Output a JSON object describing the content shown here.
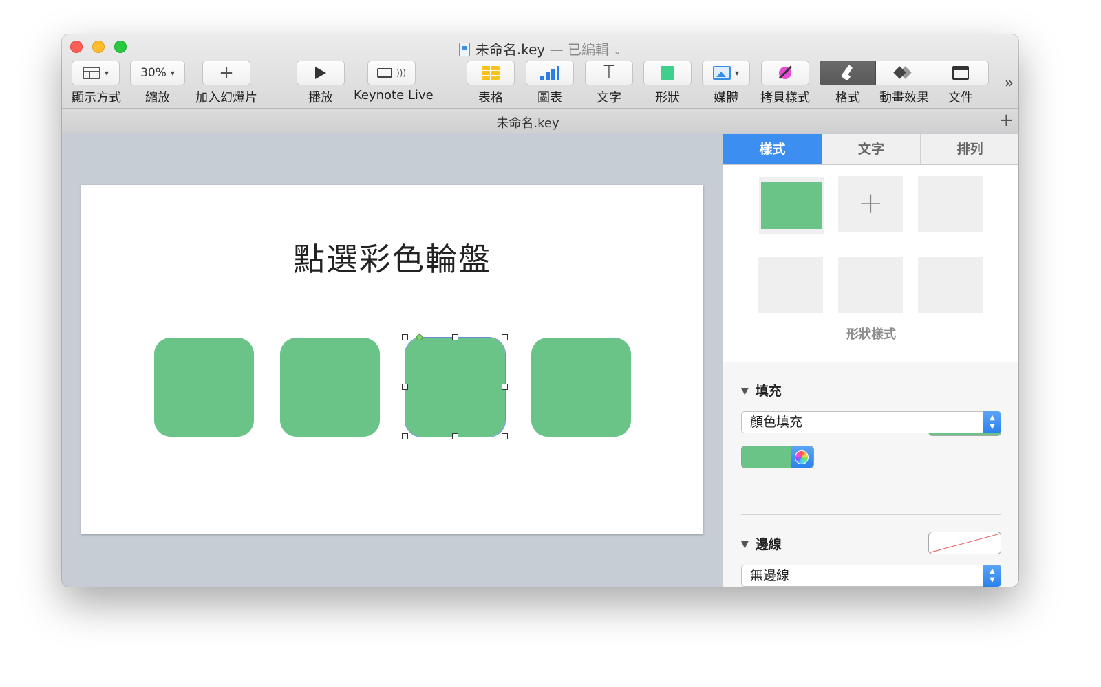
{
  "window": {
    "title": "未命名.key",
    "title_edited": "— 已編輯",
    "doc_tab": "未命名.key"
  },
  "toolbar": {
    "view": {
      "label": "顯示方式"
    },
    "zoom": {
      "label": "縮放",
      "value": "30%"
    },
    "add_slide": {
      "label": "加入幻燈片"
    },
    "play": {
      "label": "播放"
    },
    "keynote_live": {
      "label": "Keynote Live"
    },
    "table": {
      "label": "表格"
    },
    "chart": {
      "label": "圖表"
    },
    "text": {
      "label": "文字"
    },
    "shape": {
      "label": "形狀"
    },
    "media": {
      "label": "媒體"
    },
    "copy_style": {
      "label": "拷貝樣式"
    },
    "format": {
      "label": "格式"
    },
    "animate": {
      "label": "動畫效果"
    },
    "document": {
      "label": "文件"
    }
  },
  "slide": {
    "title": "點選彩色輪盤",
    "shape_color": "#6ac387"
  },
  "inspector": {
    "tabs": [
      "樣式",
      "文字",
      "排列"
    ],
    "active_tab": "樣式",
    "styles_caption": "形狀樣式",
    "fill": {
      "title": "填充",
      "popup_value": "顏色填充",
      "color": "#6ac387"
    },
    "border": {
      "title": "邊線",
      "popup_value": "無邊線"
    }
  },
  "colors": {
    "accent": "#3c8ff0",
    "shape_green": "#6ac387"
  }
}
